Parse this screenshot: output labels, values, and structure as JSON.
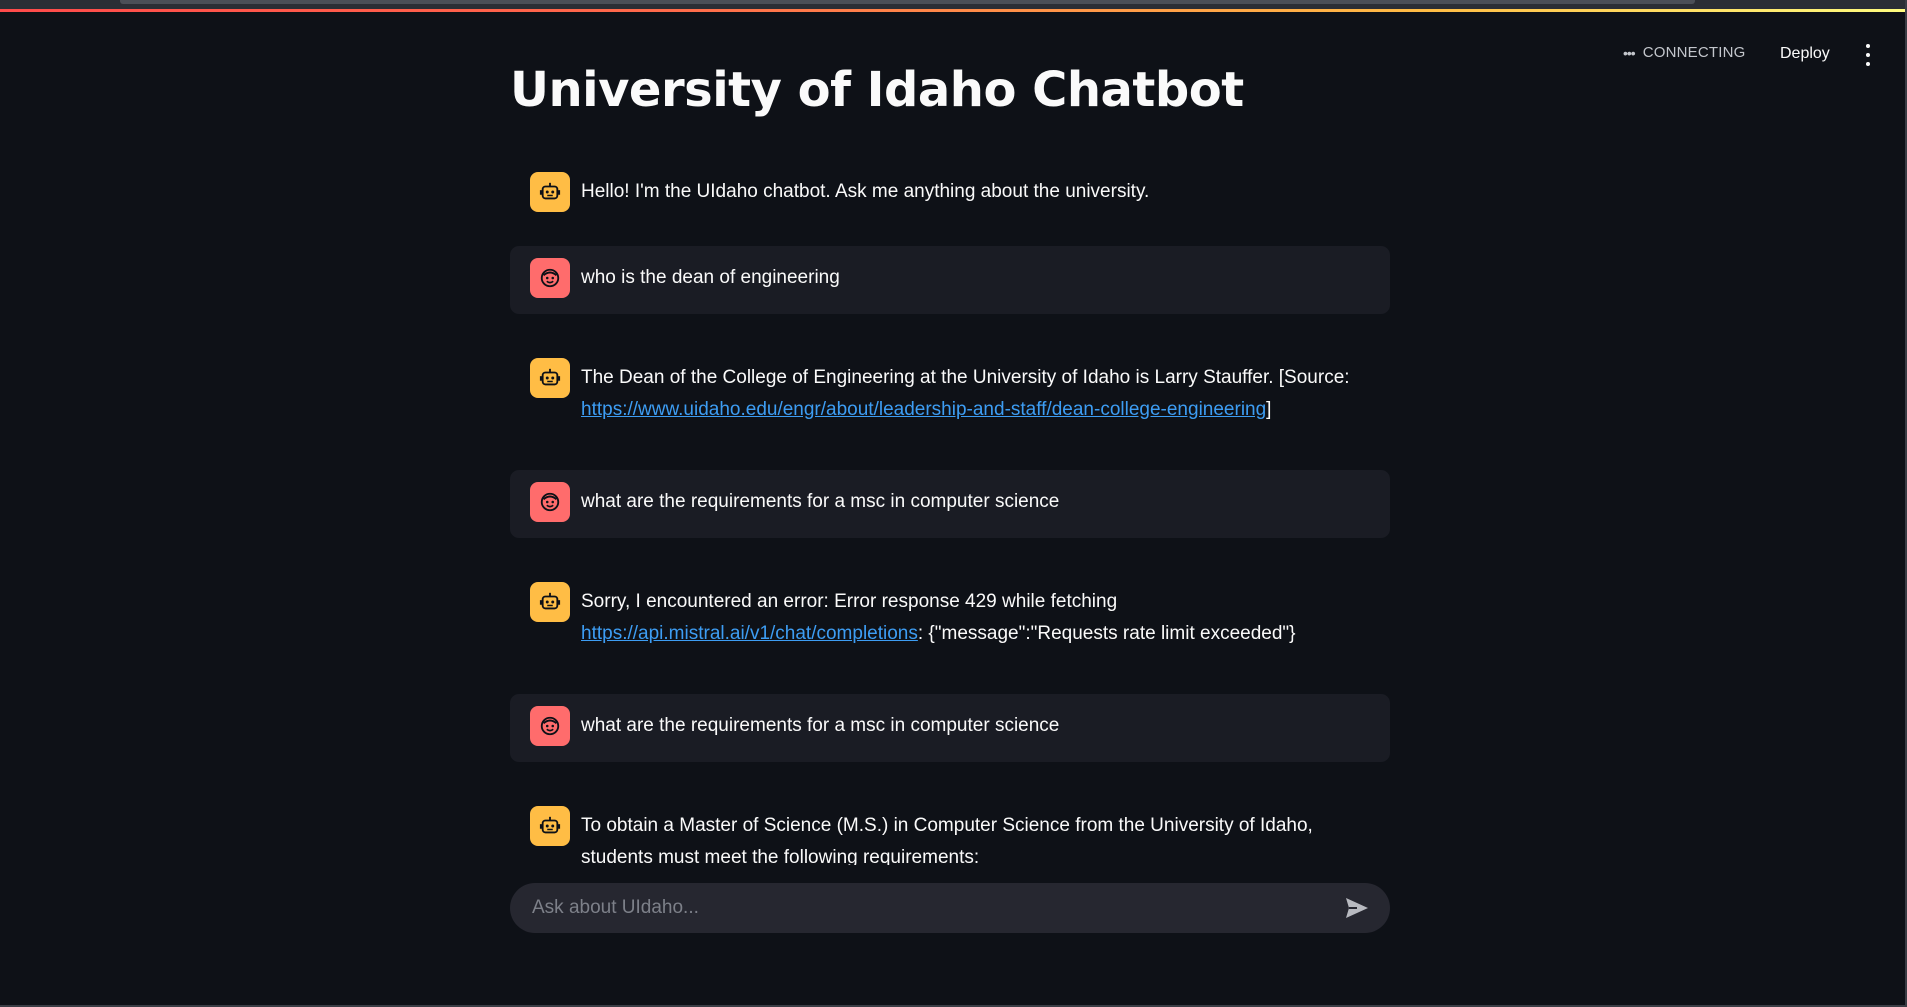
{
  "header": {
    "status_text": "CONNECTING",
    "deploy_label": "Deploy"
  },
  "page": {
    "title": "University of Idaho Chatbot"
  },
  "messages": [
    {
      "role": "assistant",
      "text": "Hello! I'm the UIdaho chatbot. Ask me anything about the university."
    },
    {
      "role": "user",
      "text": "who is the dean of engineering"
    },
    {
      "role": "assistant",
      "text_before": "The Dean of the College of Engineering at the University of Idaho is Larry Stauffer. [Source: ",
      "link": "https://www.uidaho.edu/engr/about/leadership-and-staff/dean-college-engineering",
      "text_after": "]"
    },
    {
      "role": "user",
      "text": "what are the requirements for a msc in computer science"
    },
    {
      "role": "assistant",
      "text_before": "Sorry, I encountered an error: Error response 429 while fetching ",
      "link": "https://api.mistral.ai/v1/chat/completions",
      "text_after": ": {\"message\":\"Requests rate limit exceeded\"}"
    },
    {
      "role": "user",
      "text": "what are the requirements for a msc in computer science"
    },
    {
      "role": "assistant",
      "text": "To obtain a Master of Science (M.S.) in Computer Science from the University of Idaho, students must meet the following requirements:"
    }
  ],
  "chat_input": {
    "placeholder": "Ask about UIdaho..."
  },
  "icons": {
    "assistant_avatar": "robot-icon",
    "user_avatar": "smiley-face-icon",
    "send": "send-icon",
    "menu": "vertical-ellipsis-icon",
    "status": "horizontal-ellipsis-icon"
  },
  "colors": {
    "background": "#0e1117",
    "user_message_bg": "#1a1c24",
    "assistant_avatar": "#ffbd45",
    "user_avatar": "#ff6c6c",
    "link": "#3d9df3",
    "input_bg": "#262730"
  }
}
